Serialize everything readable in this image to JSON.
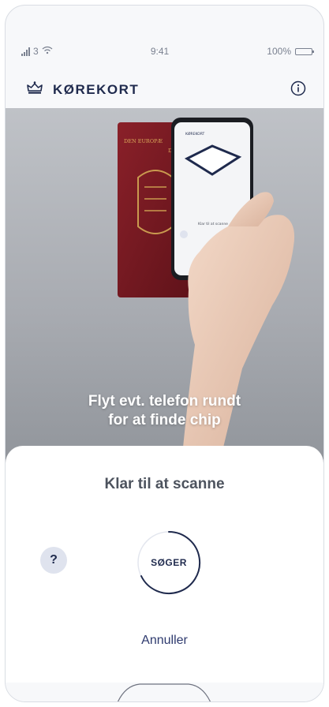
{
  "status_bar": {
    "carrier": "3",
    "time": "9:41",
    "battery": "100%",
    "battery_level": 1.0
  },
  "header": {
    "title": "KØREKORT",
    "logo_icon": "crown-icon",
    "info_icon": "info-icon"
  },
  "hero": {
    "caption_line1": "Flyt evt. telefon rundt",
    "caption_line2": "for at finde chip",
    "passport_text_1": "DEN EUROPÆ",
    "passport_text_2": "DANM",
    "phone_screen_title": "KØREKORT",
    "phone_screen_status": "Klar til at scanne"
  },
  "scan": {
    "title": "Klar til at scanne",
    "status": "SØGER",
    "help_label": "?",
    "cancel_label": "Annuller"
  },
  "colors": {
    "primary": "#1f2a4d",
    "passport": "#7a1d24",
    "help_bg": "#dfe3ee"
  }
}
